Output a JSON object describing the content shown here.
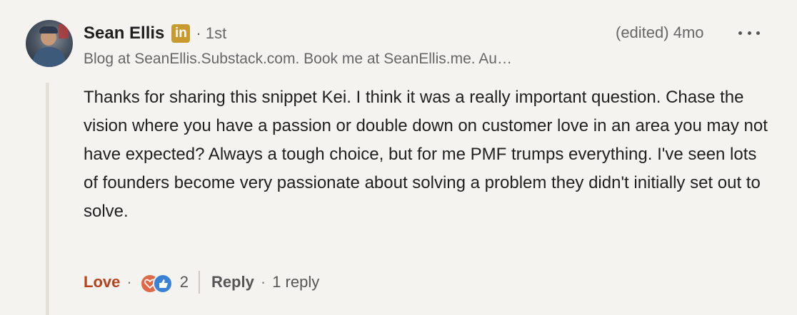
{
  "comment": {
    "author": {
      "name": "Sean Ellis",
      "badge_letters": "in",
      "connection": "· 1st",
      "headline": "Blog at SeanEllis.Substack.com. Book me at SeanEllis.me. Au…"
    },
    "meta": {
      "edited": "(edited)",
      "age": "4mo"
    },
    "body": "Thanks for sharing this snippet Kei. I think it was a really important question. Chase the vision where you have a passion or double down on customer love in an area you may not have expected? Always a tough choice, but for me PMF trumps everything. I've seen lots of founders become very passionate about solving a problem they didn't initially set out to solve.",
    "actions": {
      "reaction_label": "Love",
      "separator": "·",
      "reaction_count": "2",
      "reply_label": "Reply",
      "reply_separator": "·",
      "reply_count_text": "1 reply"
    },
    "icons": [
      "avatar",
      "linkedin-icon",
      "more-options-icon",
      "heart-reaction-icon",
      "like-reaction-icon"
    ],
    "colors": {
      "love": "#b3431d",
      "badge": "#c99a2e",
      "heart": "#e06847",
      "like": "#3b82d6"
    }
  }
}
